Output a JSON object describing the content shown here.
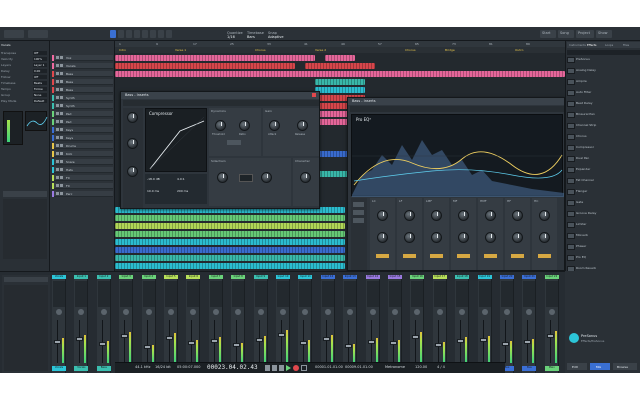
{
  "colors": {
    "blue": "#3b6fd6",
    "cyan": "#2cc5d8",
    "green": "#6ad27a",
    "lime": "#b8e05a",
    "pink": "#f06aa0",
    "red": "#e0484d",
    "yellow": "#e6c54a",
    "teal": "#3bbfb0",
    "purple": "#9a7ae0"
  },
  "toolbar": {
    "quantize": "Quantize",
    "quantize_val": "1/16",
    "timebase": "Timebase",
    "timebase_val": "Bars",
    "snap": "Snap",
    "snap_val": "Adaptive",
    "start": "Start",
    "song": "Song",
    "project": "Project",
    "show": "Show"
  },
  "inspector": {
    "track_title": "Vocals",
    "rows": [
      "Transpose",
      "Velocity",
      "Layers",
      "Delay",
      "Follow",
      "Timebase",
      "Tempo",
      "Group",
      "Play Mode"
    ],
    "vals": [
      "Off",
      "100%",
      "Layer 1",
      "0.00",
      "Off",
      "Beats",
      "Follow",
      "None",
      "Default"
    ]
  },
  "tracks": {
    "names": [
      "Vox",
      "Vocals",
      "Bass",
      "Bass",
      "Bass",
      "Synth",
      "Synth",
      "Pad",
      "Pad",
      "Keys",
      "Keys",
      "Drums",
      "Kick",
      "Snare",
      "Hats",
      "FX",
      "FX",
      "Perc"
    ]
  },
  "arrange": {
    "ruler_marks": [
      "1",
      "9",
      "17",
      "25",
      "33",
      "41",
      "49",
      "57",
      "65",
      "73",
      "81",
      "89"
    ],
    "markers": [
      "Intro",
      "Verse 1",
      "Chorus",
      "Verse 2",
      "Chorus",
      "Bridge",
      "Outro"
    ]
  },
  "compressor": {
    "window_title": "Bass - Inserts",
    "title": "Compressor",
    "sections": [
      "Dynamics",
      "Gain",
      "Sidechain",
      "Character"
    ],
    "knob_labels": [
      "Threshold",
      "Ratio",
      "Attack",
      "Release",
      "Input",
      "Output"
    ],
    "readouts": [
      "-18.0 dB",
      "4.0:1",
      "10.0 ms",
      "200 ms"
    ]
  },
  "proeq": {
    "window_title": "Bass - Inserts",
    "title": "Pro EQ³",
    "bands": [
      "LC",
      "LF",
      "LMF",
      "MF",
      "HMF",
      "HF",
      "HC"
    ]
  },
  "browser": {
    "tabs": [
      "Instruments",
      "Effects",
      "Loops",
      "Files"
    ],
    "items": [
      "PreSonus",
      "Analog Delay",
      "Ampire",
      "Auto Filter",
      "Beat Delay",
      "Binaural Pan",
      "Channel Strip",
      "Chorus",
      "Compressor",
      "Dual Pan",
      "Expander",
      "Fat Channel",
      "Flanger",
      "Gate",
      "Groove Delay",
      "Limiter",
      "Mixverb",
      "Phaser",
      "Pro EQ",
      "Room Reverb"
    ],
    "footer_title": "PreSonus",
    "footer_sub": "Effects/PreSonus"
  },
  "mixer": {
    "strips": [
      {
        "name": "Vocals",
        "foot": "Vocals",
        "color": "#2cc5d8",
        "level": 0.55
      },
      {
        "name": "Input 1",
        "foot": "Vocals",
        "color": "#3bbfb0",
        "level": 0.62
      },
      {
        "name": "Input 2",
        "foot": "Bass",
        "color": "#3bbfb0",
        "level": 0.48
      },
      {
        "name": "Input 3",
        "foot": "Bass",
        "color": "#6ad27a",
        "level": 0.7
      },
      {
        "name": "Input 4",
        "foot": "Synth",
        "color": "#6ad27a",
        "level": 0.4
      },
      {
        "name": "Input 5",
        "foot": "Synth",
        "color": "#b8e05a",
        "level": 0.66
      },
      {
        "name": "Input 6",
        "foot": "Pad",
        "color": "#b8e05a",
        "level": 0.52
      },
      {
        "name": "Input 7",
        "foot": "Pad",
        "color": "#6ad27a",
        "level": 0.58
      },
      {
        "name": "Input 8",
        "foot": "Keys",
        "color": "#6ad27a",
        "level": 0.45
      },
      {
        "name": "Input 9",
        "foot": "Keys",
        "color": "#3bbfb0",
        "level": 0.6
      },
      {
        "name": "Input 10",
        "foot": "Drums",
        "color": "#2cc5d8",
        "level": 0.73
      },
      {
        "name": "Input 11",
        "foot": "Kick",
        "color": "#2cc5d8",
        "level": 0.5
      },
      {
        "name": "Input 12",
        "foot": "Snare",
        "color": "#3b6fd6",
        "level": 0.63
      },
      {
        "name": "Input 13",
        "foot": "Hats",
        "color": "#3b6fd6",
        "level": 0.42
      },
      {
        "name": "Input 14",
        "foot": "FX",
        "color": "#9a7ae0",
        "level": 0.55
      },
      {
        "name": "Input 15",
        "foot": "FX",
        "color": "#9a7ae0",
        "level": 0.5
      },
      {
        "name": "Input 16",
        "foot": "Perc",
        "color": "#6ad27a",
        "level": 0.68
      },
      {
        "name": "Input 17",
        "foot": "Perc",
        "color": "#b8e05a",
        "level": 0.46
      },
      {
        "name": "Input 18",
        "foot": "Aux",
        "color": "#3bbfb0",
        "level": 0.57
      },
      {
        "name": "Input 19",
        "foot": "Aux",
        "color": "#2cc5d8",
        "level": 0.61
      },
      {
        "name": "Input 20",
        "foot": "Bus",
        "color": "#3b6fd6",
        "level": 0.49
      },
      {
        "name": "Input 21",
        "foot": "Bus",
        "color": "#3b6fd6",
        "level": 0.54
      },
      {
        "name": "Input 22",
        "foot": "Main",
        "color": "#6ad27a",
        "level": 0.72
      }
    ]
  },
  "transport": {
    "sample_rate": "44.1 kHz",
    "bits": "16/24 bit",
    "record_time": "05:00:07.000",
    "main_time": "00023.04.02.43",
    "loop_start": "00001.01.01.00",
    "loop_end": "00009.01.01.00",
    "tempo": "120.00",
    "sig": "4 / 4",
    "metronome": "Metronome",
    "edit": "Edit",
    "mix": "Mix",
    "browse": "Browse"
  }
}
